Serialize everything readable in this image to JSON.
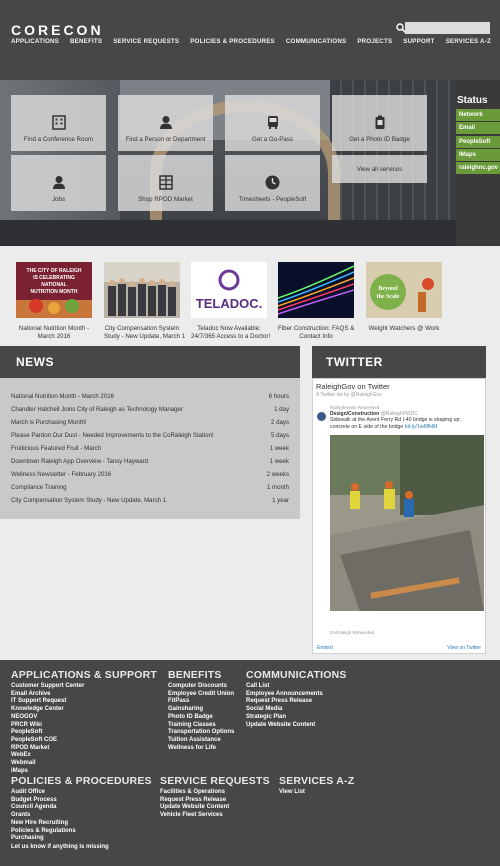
{
  "header": {
    "logo": "CORECON",
    "search_placeholder": "",
    "nav": [
      "APPLICATIONS",
      "BENEFITS",
      "SERVICE REQUESTS",
      "POLICIES & PROCEDURES",
      "COMMUNICATIONS",
      "PROJECTS",
      "SUPPORT",
      "SERVICES A-Z"
    ]
  },
  "hero": {
    "tiles": [
      {
        "label": "Find a Conference Room",
        "icon": "building-icon"
      },
      {
        "label": "Find a Person or Department",
        "icon": "person-icon"
      },
      {
        "label": "Get a Go-Pass",
        "icon": "bus-icon"
      },
      {
        "label": "Get a Photo ID Badge",
        "icon": "badge-icon"
      },
      {
        "label": "Jobs",
        "icon": "people-icon"
      },
      {
        "label": "Shop RPOD Market",
        "icon": "store-icon"
      },
      {
        "label": "Timesheets - PeopleSoft",
        "icon": "clock-icon"
      },
      {
        "label": "View all services",
        "icon": ""
      }
    ]
  },
  "status": {
    "title": "Status",
    "items": [
      "Network",
      "Email",
      "PeopleSoft",
      "IMaps",
      "raleighnc.gov"
    ]
  },
  "thumbs": [
    {
      "line1": "National Nutrition Month -",
      "line2": "March 2016",
      "img_text": "THE CITY OF RALEIGH IS CELEBRATING NATIONAL NUTRITION MONTH"
    },
    {
      "line1": "City Compensation System",
      "line2": "Study - New Update, March 1",
      "img_text": ""
    },
    {
      "line1": "Teladoc Now Available:",
      "line2": "24/7/365 Access to a Doctor!",
      "img_text": "TELADOC."
    },
    {
      "line1": "Fiber Construction: FAQS &",
      "line2": "Contact Info",
      "img_text": ""
    },
    {
      "line1": "Weight Watchers @ Work",
      "line2": "",
      "img_text": "Beyond the Scale"
    }
  ],
  "news": {
    "title": "NEWS",
    "items": [
      {
        "title": "National Nutrition Month - March 2016",
        "time": "6 hours"
      },
      {
        "title": "Chandler Hatchell Joins City of Raleigh as Technology Manager",
        "time": "1 day"
      },
      {
        "title": "March is Purchasing Month!",
        "time": "2 days"
      },
      {
        "title": "Please Pardon Our Dust - Needed Improvements to the CoRaleigh Station!",
        "time": "5 days"
      },
      {
        "title": "Fruiticious Featured Fruit - March",
        "time": "1 week"
      },
      {
        "title": "Downtown Raleigh App Overview - Tansy Hayward",
        "time": "1 week"
      },
      {
        "title": "Wellness Newsletter - February 2016",
        "time": "2 weeks"
      },
      {
        "title": "Compliance Training",
        "time": "1 month"
      },
      {
        "title": "City Compensation System Study - New Update, March 1",
        "time": "1 year"
      }
    ]
  },
  "twitter": {
    "title": "TWITTER",
    "widget_title": "RaleighGov on Twitter",
    "widget_sub": "A Twitter list by @RaleighGov",
    "retweeted": "RaleighNews Retweeted",
    "author": "Design/Construction",
    "handle": "@RaleighPWDC",
    "text": "Sidewalk at the Avent Ferry Rd I-40 bridge is shaping up; concrete on E side of the bridge",
    "link": "bit.ly/1wMfHM",
    "retweeted2": "GoRaleigh Retweeted",
    "embed": "Embed",
    "view": "View on Twitter"
  },
  "footer": {
    "columns": [
      {
        "heading": "APPLICATIONS & SUPPORT",
        "items": [
          "Customer Support Center",
          "Email Archive",
          "IT Support Request",
          "Knowledge Center",
          "NEOGOV",
          "PRCR Wiki",
          "PeopleSoft",
          "PeopleSoft COE",
          "RPOD Market",
          "WebEx",
          "Webmail",
          "iMaps"
        ]
      },
      {
        "heading": "BENEFITS",
        "items": [
          "Computer Discounts",
          "Employee Credit Union",
          "FitPass",
          "Gainsharing",
          "Photo ID Badge",
          "Training Classes",
          "Transportation Options",
          "Tuition Assistance",
          "Wellness for Life"
        ]
      },
      {
        "heading": "COMMUNICATIONS",
        "items": [
          "Call List",
          "Employee Announcements",
          "Request Press Release",
          "Social Media",
          "Strategic Plan",
          "Update Website Content"
        ]
      },
      {
        "heading": "POLICIES & PROCEDURES",
        "items": [
          "Audit Office",
          "Budget Process",
          "Council Agenda",
          "Grants",
          "New Hire Recruiting",
          "Policies & Regulations",
          "Purchasing"
        ]
      },
      {
        "heading": "SERVICE REQUESTS",
        "items": [
          "Facilities & Operations",
          "Request Press Release",
          "Update Website Content",
          "Vehicle Fleet Services"
        ]
      },
      {
        "heading": "SERVICES A-Z",
        "items": [
          "View List"
        ]
      }
    ],
    "missing": "Let us know if anything is missing"
  }
}
